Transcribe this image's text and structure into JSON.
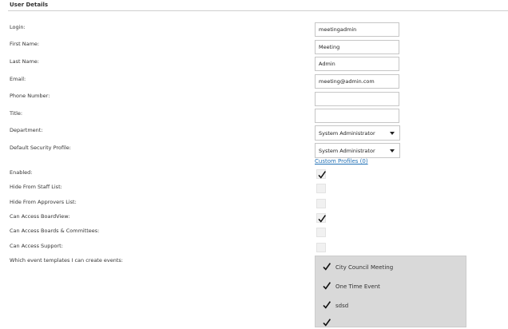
{
  "section": {
    "title": "User Details"
  },
  "labels": {
    "login": "Login:",
    "first_name": "First Name:",
    "last_name": "Last Name:",
    "email": "Email:",
    "phone": "Phone Number:",
    "title": "Title:",
    "department": "Department:",
    "security_profile": "Default Security Profile:",
    "enabled": "Enabled:",
    "hide_staff": "Hide From Staff List:",
    "hide_approvers": "Hide From Approvers List:",
    "access_boardview": "Can Access BoardView:",
    "access_boards": "Can Access Boards & Committees:",
    "access_support": "Can Access Support:",
    "event_templates": "Which event templates I can create events:"
  },
  "fields": {
    "login": "meetingadmin",
    "first_name": "Meeting",
    "last_name": "Admin",
    "email": "meeting@admin.com",
    "phone": "",
    "title": ""
  },
  "selects": {
    "department": "System Administrator",
    "security_profile": "System Administrator"
  },
  "custom_profiles_link": "Custom Profiles (0)",
  "checkboxes": {
    "enabled": true,
    "hide_staff": false,
    "hide_approvers": false,
    "access_boardview": true,
    "access_boards": false,
    "access_support": false
  },
  "event_templates": [
    {
      "label": "City Council Meeting",
      "checked": true
    },
    {
      "label": "One Time Event",
      "checked": true
    },
    {
      "label": "sdsd",
      "checked": true
    }
  ],
  "icons": {
    "check": "checkmark-icon",
    "dropdown": "chevron-down-icon"
  }
}
